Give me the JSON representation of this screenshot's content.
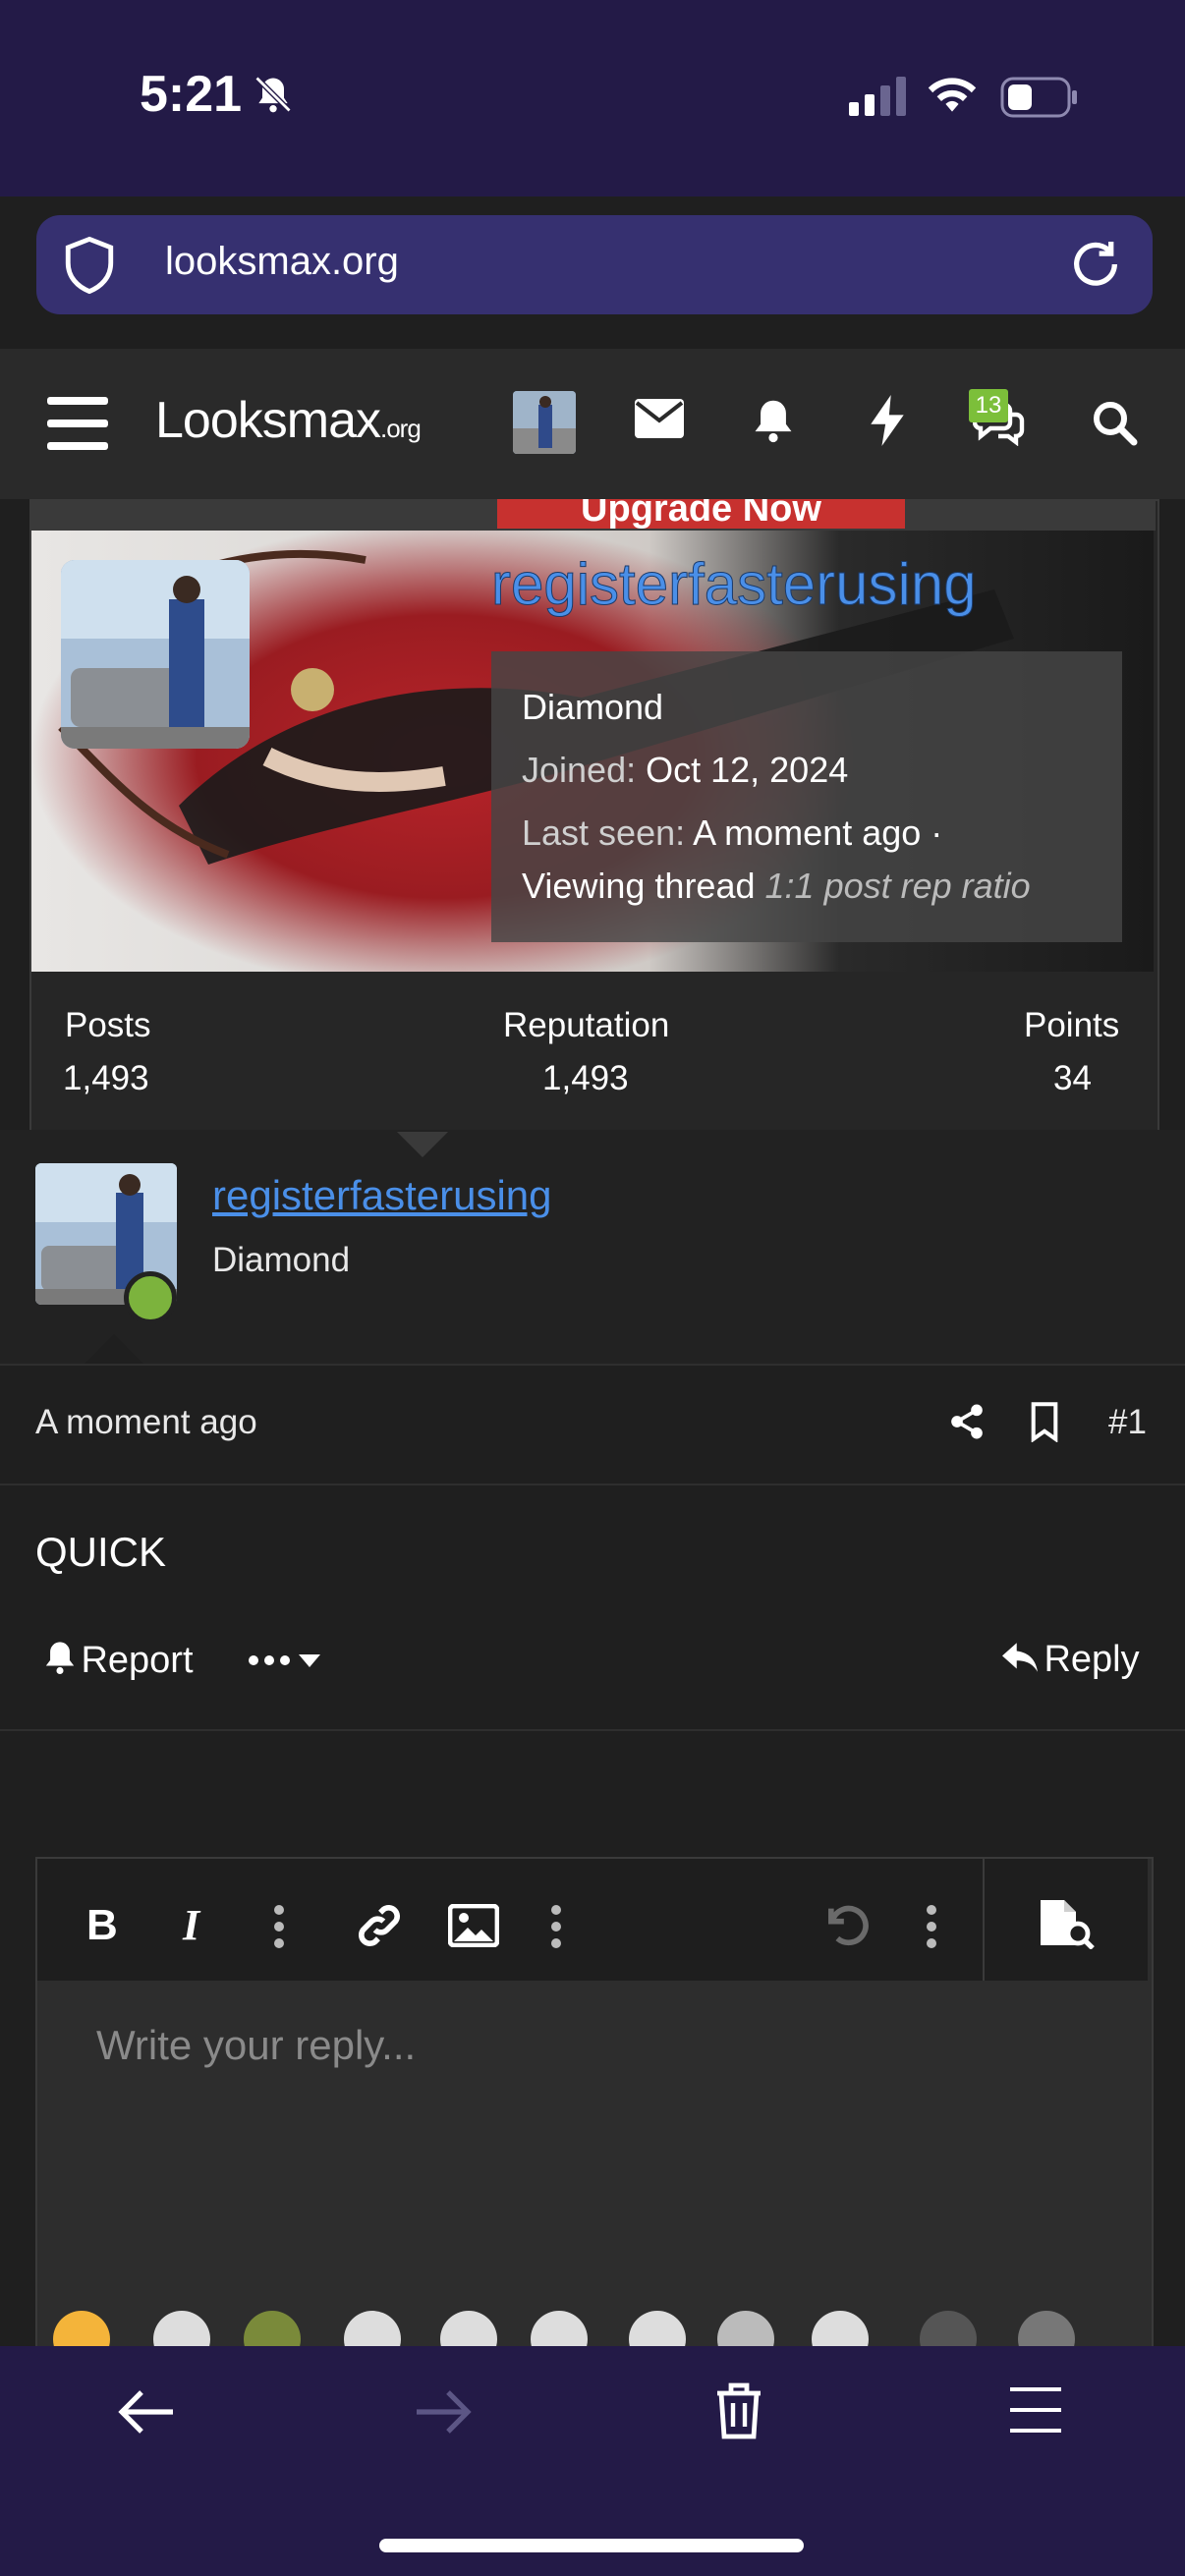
{
  "status_bar": {
    "time": "5:21",
    "icons": [
      "bell-slash-icon",
      "signal-icon",
      "wifi-icon",
      "battery-icon"
    ]
  },
  "browser": {
    "url": "looksmax.org"
  },
  "site_nav": {
    "logo_main": "Looksmax",
    "logo_suffix": ".org",
    "conversations_badge": "13"
  },
  "profile_card": {
    "upgrade_label": "Upgrade Now",
    "username": "registerfasterusing",
    "rank": "Diamond",
    "joined_label": "Joined:",
    "joined_value": "Oct 12, 2024",
    "last_seen_label": "Last seen:",
    "last_seen_value": "A moment ago ·",
    "activity": "Viewing thread",
    "ratio": "1:1 post rep ratio",
    "stats": [
      {
        "label": "Posts",
        "value": "1,493"
      },
      {
        "label": "Reputation",
        "value": "1,493"
      },
      {
        "label": "Points",
        "value": "34"
      }
    ]
  },
  "post": {
    "username": "registerfasterusing",
    "rank": "Diamond",
    "time": "A moment ago",
    "number": "#1",
    "body": "QUICK",
    "report_label": "Report",
    "reply_label": "Reply"
  },
  "editor": {
    "placeholder": "Write your reply..."
  }
}
